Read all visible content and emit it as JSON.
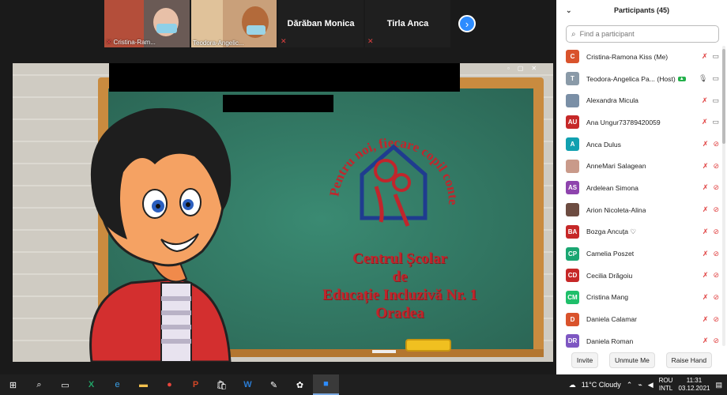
{
  "video_strip": {
    "tiles": [
      {
        "name": "Cristina-Ram..."
      },
      {
        "name": "Teodora-Angelic..."
      },
      {
        "name": "Dărăban Monica"
      },
      {
        "name": "Tirla Anca"
      }
    ]
  },
  "share": {
    "board_lines": [
      "Centrul Școlar",
      "de",
      "Educație Incluzivă Nr. 1",
      "Oradea"
    ],
    "logo_arc": "Pentru noi, fiecare copil contează"
  },
  "panel": {
    "title": "Participants (45)",
    "search_placeholder": "Find a participant",
    "participants": [
      {
        "initials": "C",
        "name": "Cristina-Ramona Kiss (Me)",
        "color": "#d9532c",
        "mic": "off",
        "cam": "on"
      },
      {
        "initials": "T",
        "name": "Teodora-Angelica Pa... (Host)",
        "color": "#8a9aa8",
        "mic": "on",
        "cam": "on",
        "host": true
      },
      {
        "initials": "",
        "name": "Alexandra Micula",
        "color": "#7a8fa6",
        "mic": "off",
        "cam": "on"
      },
      {
        "initials": "AU",
        "name": "Ana Ungur73789420059",
        "color": "#c62828",
        "mic": "off",
        "cam": "on"
      },
      {
        "initials": "A",
        "name": "Anca Dulus",
        "color": "#11a0b0",
        "mic": "off",
        "cam": "off"
      },
      {
        "initials": "",
        "name": "AnneMari Salagean",
        "color": "#c99a8a",
        "mic": "off",
        "cam": "off"
      },
      {
        "initials": "AS",
        "name": "Ardelean Simona",
        "color": "#8e44ad",
        "mic": "off",
        "cam": "off"
      },
      {
        "initials": "",
        "name": "Arion Nicoleta-Alina",
        "color": "#6d4c41",
        "mic": "off",
        "cam": "off"
      },
      {
        "initials": "BA",
        "name": "Bozga Ancuța ♡",
        "color": "#c62828",
        "mic": "off",
        "cam": "off"
      },
      {
        "initials": "CP",
        "name": "Camelia Poszet",
        "color": "#1aa672",
        "mic": "off",
        "cam": "off"
      },
      {
        "initials": "CD",
        "name": "Cecilia Drăgoiu",
        "color": "#c62828",
        "mic": "off",
        "cam": "off"
      },
      {
        "initials": "CM",
        "name": "Cristina Mang",
        "color": "#1fbf6a",
        "mic": "off",
        "cam": "off"
      },
      {
        "initials": "D",
        "name": "Daniela Calamar",
        "color": "#d9532c",
        "mic": "off",
        "cam": "off"
      },
      {
        "initials": "DR",
        "name": "Daniela Roman",
        "color": "#7e57c2",
        "mic": "off",
        "cam": "off"
      }
    ],
    "buttons": {
      "invite": "Invite",
      "unmute": "Unmute Me",
      "raise_hand": "Raise Hand"
    }
  },
  "taskbar": {
    "weather": "11°C  Cloudy",
    "lang_top": "ROU",
    "lang_bottom": "INTL",
    "time": "11:31",
    "date": "03.12.2021"
  }
}
